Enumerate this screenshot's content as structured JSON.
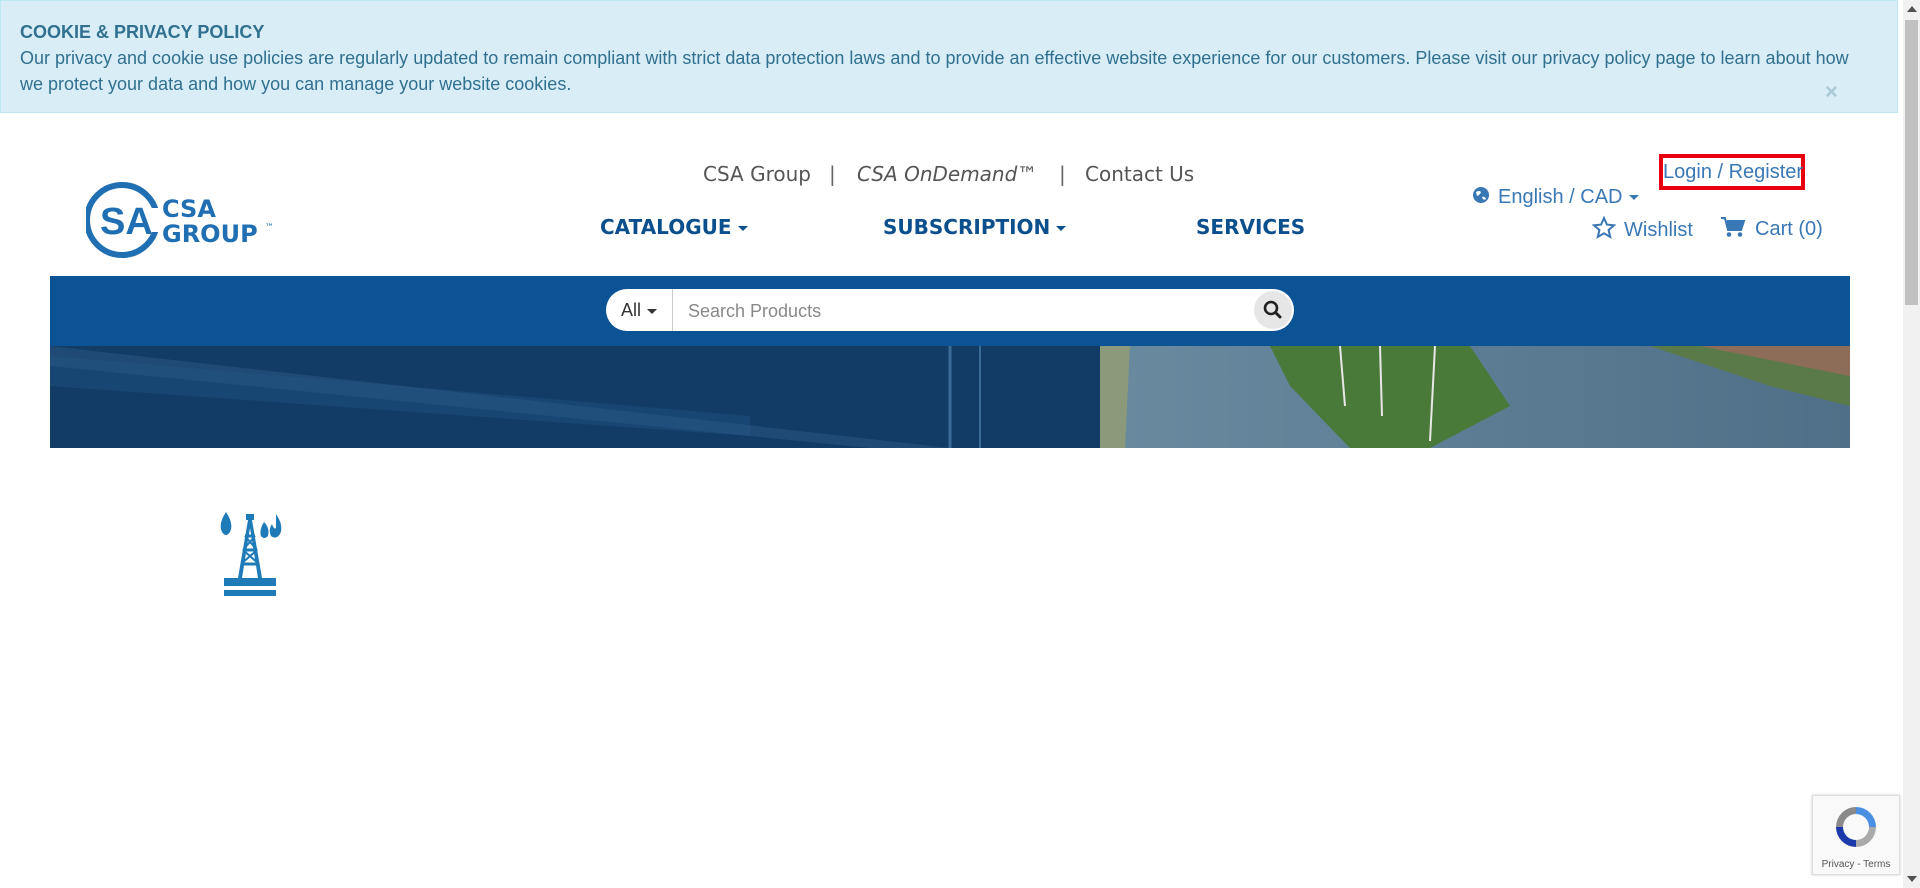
{
  "cookie_banner": {
    "title": "COOKIE & PRIVACY POLICY",
    "text": "Our privacy and cookie use policies are regularly updated to remain compliant with strict data protection laws and to provide an effective website experience for our customers. Please visit our privacy policy page to learn about how we protect your data and how you can manage your website cookies.",
    "close": "×"
  },
  "header": {
    "logo_text_line1": "CSA",
    "logo_text_line2": "GROUP",
    "logo_tm": "™",
    "logo_mark": "SA",
    "top_links": {
      "csa_group": "CSA Group",
      "separator": "|",
      "ondemand": "CSA OnDemand™",
      "contact": "Contact Us"
    },
    "nav": {
      "catalogue": "CATALOGUE",
      "subscription": "SUBSCRIPTION",
      "services": "SERVICES"
    },
    "language": "English / CAD",
    "login": "Login / Register",
    "wishlist": "Wishlist",
    "cart": "Cart (0)"
  },
  "search": {
    "category": "All",
    "placeholder": "Search Products"
  },
  "recaptcha": {
    "text": "Privacy - Terms"
  },
  "colors": {
    "brand_blue": "#0b5395",
    "link_blue": "#3a78b5",
    "login_highlight": "#e8000f",
    "cookie_bg": "#d9edf7"
  }
}
